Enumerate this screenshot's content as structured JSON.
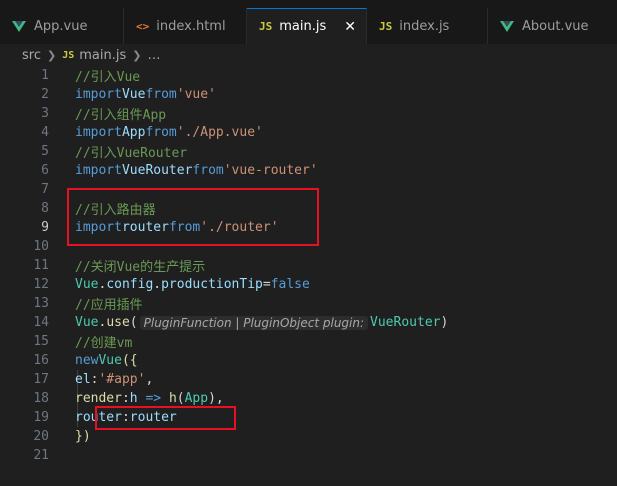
{
  "tabs": [
    {
      "label": "App.vue",
      "icon": "vue-icon",
      "active": false
    },
    {
      "label": "index.html",
      "icon": "html-icon",
      "active": false
    },
    {
      "label": "main.js",
      "icon": "js-icon",
      "active": true
    },
    {
      "label": "index.js",
      "icon": "js-icon",
      "active": false
    },
    {
      "label": "About.vue",
      "icon": "vue-icon",
      "active": false
    }
  ],
  "tab_close": "✕",
  "breadcrumb": {
    "folder": "src",
    "file": "main.js",
    "more": "…",
    "file_icon": "JS"
  },
  "line_numbers": [
    "1",
    "2",
    "3",
    "4",
    "5",
    "6",
    "7",
    "8",
    "9",
    "10",
    "11",
    "12",
    "13",
    "14",
    "15",
    "16",
    "17",
    "18",
    "19",
    "20",
    "21"
  ],
  "current_line": "9",
  "code": {
    "l1": "//引入Vue",
    "l2_kw": "import",
    "l2_var": "Vue",
    "l2_from": "from",
    "l2_str": "'vue'",
    "l3": "//引入组件App",
    "l4_kw": "import",
    "l4_var": "App",
    "l4_from": "from",
    "l4_str": "'./App.vue'",
    "l5": "//引入VueRouter",
    "l6_kw": "import",
    "l6_var": "VueRouter",
    "l6_from": "from",
    "l6_str": "'vue-router'",
    "l8": "//引入路由器",
    "l9_kw": "import",
    "l9_var": "router",
    "l9_from": "from",
    "l9_str": "'./router'",
    "l11": "//关闭Vue的生产提示",
    "l12_obj": "Vue",
    "l12_dot1": ".",
    "l12_prop1": "config",
    "l12_dot2": ".",
    "l12_prop2": "productionTip",
    "l12_eq": "=",
    "l12_val": "false",
    "l13": "//应用插件",
    "l14_obj": "Vue",
    "l14_dot": ".",
    "l14_fn": "use",
    "l14_paren": "(",
    "l14_hint": "PluginFunction | PluginObject plugin:",
    "l14_arg": "VueRouter",
    "l14_close": ")",
    "l15": "//创建vm",
    "l16_kw": "new",
    "l16_cls": "Vue",
    "l16_open": "({",
    "l17_key": "el",
    "l17_colon": ":",
    "l17_str": "'#app'",
    "l17_comma": ",",
    "l18_key": "render",
    "l18_colon": ":",
    "l18_param": "h",
    "l18_arrow": " => ",
    "l18_fn": "h",
    "l18_open": "(",
    "l18_arg": "App",
    "l18_close": "),",
    "l19_key": "router",
    "l19_colon": ":",
    "l19_val": "router",
    "l20": "})"
  },
  "colors": {
    "highlight_box": "#e81123",
    "active_tab_border": "#0078d4",
    "background": "#1f1f1f"
  }
}
